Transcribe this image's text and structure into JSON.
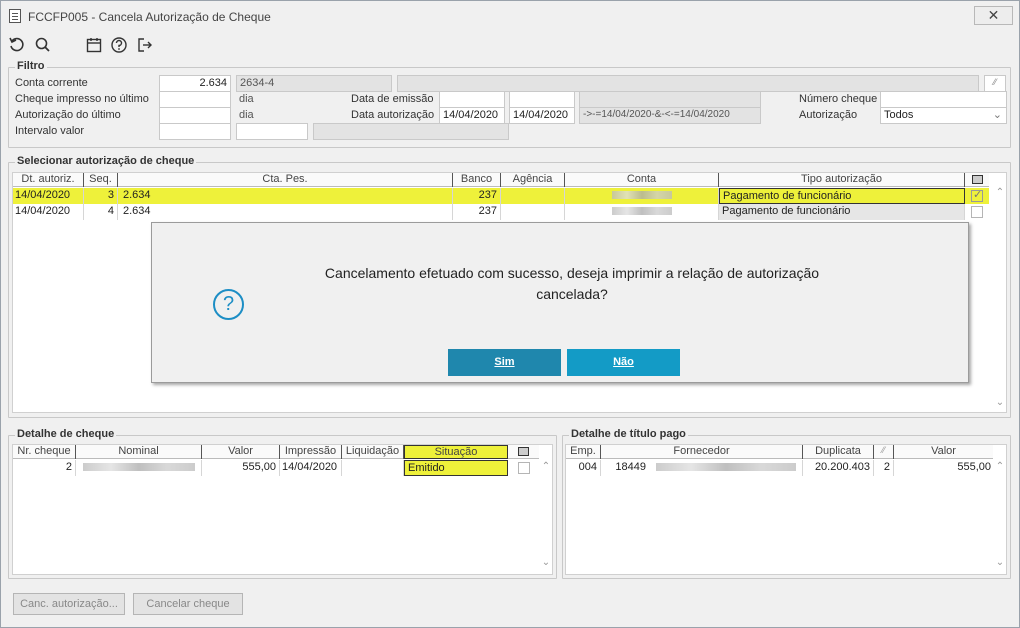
{
  "window": {
    "title": "FCCFP005 - Cancela Autorização de Cheque",
    "close_label": "✕"
  },
  "toolbar": {
    "refresh_icon": "refresh-icon",
    "search_icon": "search-icon",
    "calendar_icon": "calendar-icon",
    "help_icon": "help-icon",
    "exit_icon": "exit-icon"
  },
  "filtro": {
    "title": "Filtro",
    "conta_corrente_label": "Conta corrente",
    "conta_corrente_value": "2.634",
    "conta_code": "2634-4",
    "cheque_impresso_label": "Cheque impresso no último",
    "dia1": "dia",
    "autorizacao_ultimo_label": "Autorização do último",
    "dia2": "dia",
    "intervalo_valor_label": "Intervalo valor",
    "data_emissao_label": "Data de emissão",
    "data_autorizacao_label": "Data autorização",
    "data_aut_de": "14/04/2020",
    "data_aut_ate": "14/04/2020",
    "expression": "->-=14/04/2020-&-<-=14/04/2020",
    "numero_cheque_label": "Número cheque",
    "autorizacao_label": "Autorização",
    "autorizacao_value": "Todos"
  },
  "selecionar": {
    "title": "Selecionar autorização de cheque",
    "headers": [
      "Dt. autoriz.",
      "Seq.",
      "Cta. Pes.",
      "Banco",
      "Agência",
      "Conta",
      "Tipo autorização"
    ],
    "rows": [
      {
        "dt": "14/04/2020",
        "seq": "3",
        "cta": "2.634",
        "banco": "237",
        "tipo": "Pagamento de funcionário"
      },
      {
        "dt": "14/04/2020",
        "seq": "4",
        "cta": "2.634",
        "banco": "237",
        "tipo": "Pagamento de funcionário"
      }
    ]
  },
  "detalhe_cheque": {
    "title": "Detalhe de cheque",
    "headers": [
      "Nr. cheque",
      "Nominal",
      "Valor",
      "Impressão",
      "Liquidação",
      "Situação"
    ],
    "row": {
      "nr": "2",
      "valor": "555,00",
      "impressao": "14/04/2020",
      "situacao": "Emitido"
    }
  },
  "detalhe_titulo": {
    "title": "Detalhe de título pago",
    "headers": [
      "Emp.",
      "Fornecedor",
      "Duplicata",
      "Valor"
    ],
    "row": {
      "emp": "004",
      "fornecedor_cod": "18449",
      "duplicata": "20.200.403",
      "parcela": "2",
      "valor": "555,00"
    }
  },
  "buttons": {
    "canc_autorizacao": "Canc. autorização...",
    "cancelar_cheque": "Cancelar cheque"
  },
  "dialog": {
    "message_line1": "Cancelamento efetuado com sucesso, deseja imprimir a relação de autorização",
    "message_line2": "cancelada?",
    "icon": "question-icon",
    "sim": "Sim",
    "nao": "Não"
  },
  "colors": {
    "highlight": "#eef13a",
    "dialog_button": "#1f87ad",
    "dialog_button2": "#139bc6",
    "icon_blue": "#1d8ec5"
  }
}
